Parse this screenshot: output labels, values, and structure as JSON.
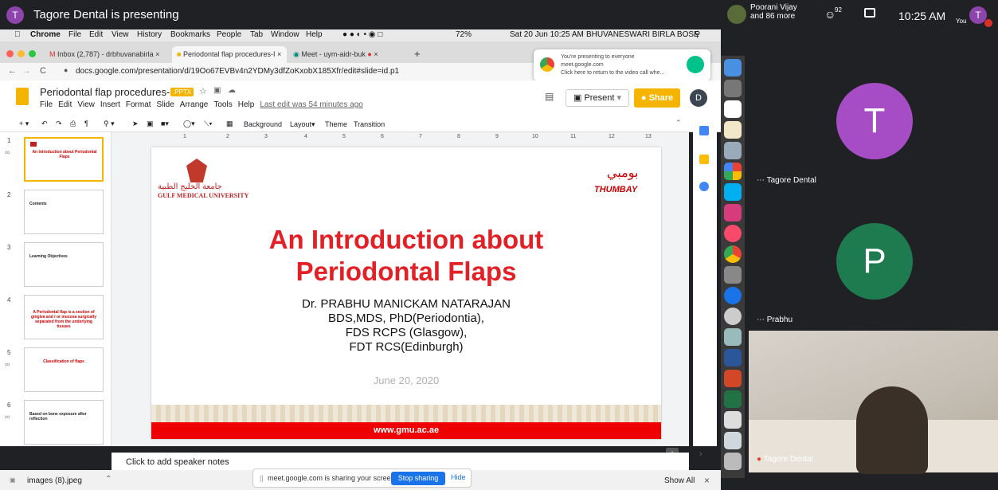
{
  "meet": {
    "presenter_initial": "T",
    "presenting_title": "Tagore Dental is presenting",
    "participant_name": "Poorani Vijay",
    "participant_more": "and 86 more",
    "people_count": "92",
    "time": "10:25 AM",
    "you_label": "You",
    "you_initial": "T"
  },
  "mac_menu": {
    "app": "Chrome",
    "items": [
      "File",
      "Edit",
      "View",
      "History",
      "Bookmarks",
      "People",
      "Tab",
      "Window",
      "Help"
    ],
    "battery": "72%",
    "datetime": "Sat 20 Jun 10:25 AM",
    "user": "BHUVANESWARI BIRLA BOSE"
  },
  "tabs": [
    {
      "label": "Inbox (2,787) - drbhuvanabirla"
    },
    {
      "label": "Periodontal flap procedures-I"
    },
    {
      "label": "Meet - uym-aidr-buk"
    }
  ],
  "url": "docs.google.com/presentation/d/19Oo67EVBv4n2YDMy3dfZoKxobX185Xfr/edit#slide=id.p1",
  "popup": {
    "line1": "You're presenting to everyone",
    "line2": "meet.google.com",
    "line3": "Click here to return to the video call whe..."
  },
  "doc": {
    "title": "Periodontal flap procedures-I",
    "badge": ".PPTX",
    "menu": [
      "File",
      "Edit",
      "View",
      "Insert",
      "Format",
      "Slide",
      "Arrange",
      "Tools",
      "Help"
    ],
    "last_edit": "Last edit was 54 minutes ago",
    "present": "Present",
    "share": "Share",
    "avatar": "D"
  },
  "toolbar": {
    "background": "Background",
    "layout": "Layout",
    "theme": "Theme",
    "transition": "Transition"
  },
  "ruler": [
    "1",
    "2",
    "3",
    "4",
    "5",
    "6",
    "7",
    "8",
    "9",
    "10",
    "11",
    "12",
    "13"
  ],
  "thumbs": [
    {
      "num": "1",
      "text": "An Introduction about Periodontal Flaps"
    },
    {
      "num": "2",
      "text": "Contents"
    },
    {
      "num": "3",
      "text": "Learning Objectives"
    },
    {
      "num": "4",
      "text": "A Periodontal flap is a section of gingiva and / or mucosa surgically separated from the underlying tissues"
    },
    {
      "num": "5",
      "text": "Classification of flaps"
    },
    {
      "num": "6",
      "text": "Based on bone exposure after reflection"
    }
  ],
  "slide": {
    "university": "GULF MEDICAL UNIVERSITY",
    "brand": "THUMBAY",
    "title_l1": "An Introduction about",
    "title_l2": "Periodontal Flaps",
    "author_l1": "Dr. PRABHU MANICKAM NATARAJAN",
    "author_l2": "BDS,MDS, PhD(Periodontia),",
    "author_l3": "FDS RCPS (Glasgow),",
    "author_l4": "FDT RCS(Edinburgh)",
    "date": "June 20, 2020",
    "footer": "www.gmu.ac.ae"
  },
  "notes": "Click to add speaker notes",
  "bottom": {
    "download": "images (8).jpeg",
    "notice": "meet.google.com is sharing your screen.",
    "stop": "Stop sharing",
    "hide": "Hide",
    "show_all": "Show All"
  },
  "participants": [
    {
      "initial": "T",
      "name": "Tagore Dental",
      "color": "#a64cc4"
    },
    {
      "initial": "P",
      "name": "Prabhu",
      "color": "#1e7b4f"
    },
    {
      "name": "Tagore Dental"
    }
  ]
}
